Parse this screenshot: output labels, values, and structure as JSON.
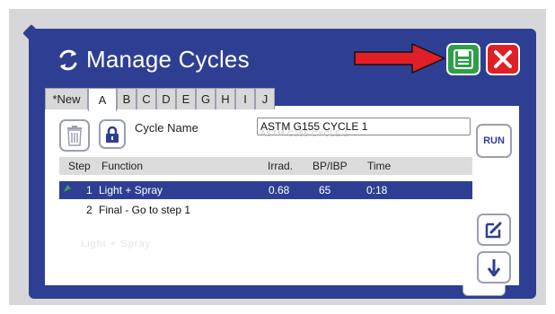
{
  "dialog": {
    "title": "Manage Cycles",
    "icons": {
      "title": "refresh-cycle-icon",
      "save": "floppy-save-icon",
      "close": "close-x-icon",
      "annotation": "red-arrow-icon"
    },
    "colors": {
      "dialog_bg": "#2e3f93",
      "save": "#2e9f49",
      "close": "#e01f26",
      "arrow": "#e01f26",
      "selected_row": "#2e3f93"
    }
  },
  "tabs": [
    {
      "label": "*New"
    },
    {
      "label": "A",
      "active": true
    },
    {
      "label": "B"
    },
    {
      "label": "C"
    },
    {
      "label": "D"
    },
    {
      "label": "E"
    },
    {
      "label": "G"
    },
    {
      "label": "H"
    },
    {
      "label": "I"
    },
    {
      "label": "J"
    }
  ],
  "cycle": {
    "name_label": "Cycle Name",
    "name_value": "ASTM G155 CYCLE 1",
    "name_ghost": "ASTM G155 CYCLE 1"
  },
  "buttons": {
    "run": "RUN",
    "trash_icon": "trash-icon",
    "lock_icon": "lock-icon",
    "edit_icon": "edit-icon",
    "down_icon": "arrow-down-icon"
  },
  "table": {
    "headers": {
      "step": "Step",
      "function": "Function",
      "irrad": "Irrad.",
      "bp": "BP/IBP",
      "time": "Time"
    },
    "rows": [
      {
        "step": "1",
        "function": "Light + Spray",
        "irrad": "0.68",
        "bp": "65",
        "time": "0:18",
        "selected": true
      },
      {
        "step": "2",
        "function": "Final - Go to step 1",
        "irrad": "",
        "bp": "",
        "time": ""
      }
    ],
    "ghost_text": "Light + Spray"
  }
}
